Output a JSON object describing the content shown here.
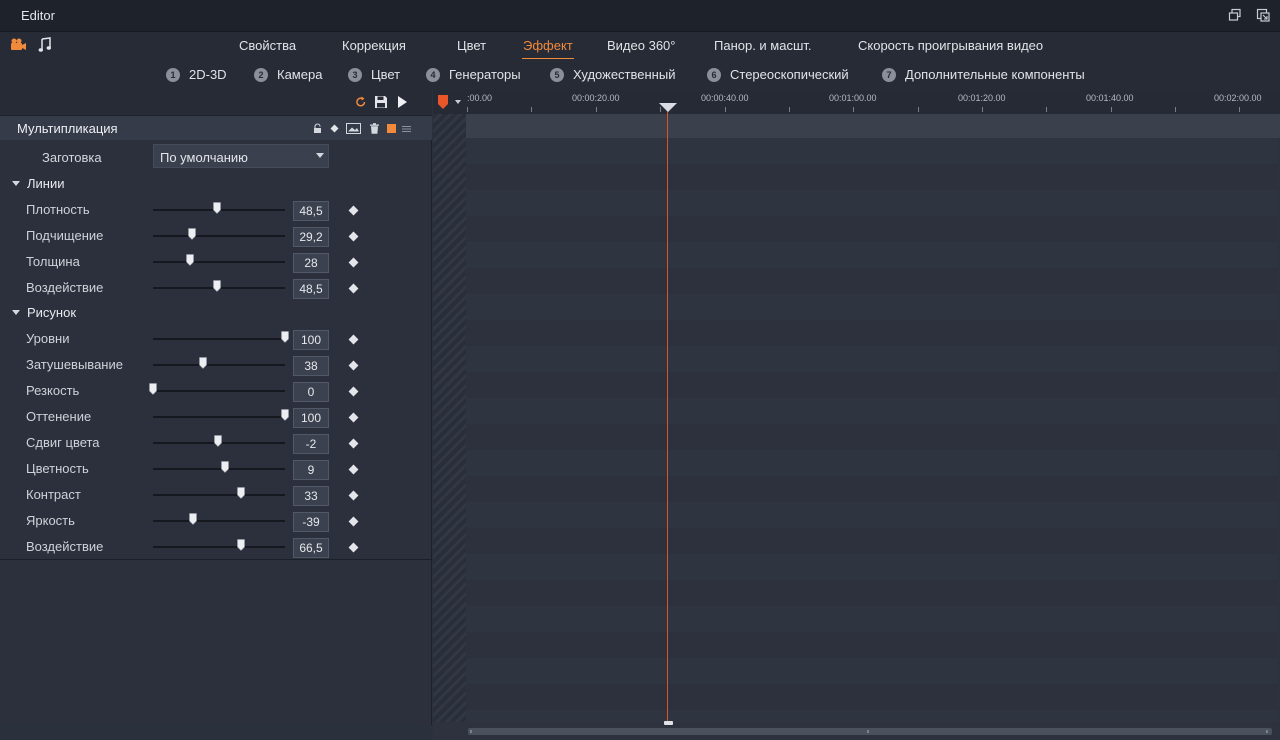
{
  "window": {
    "title": "Editor"
  },
  "media_icons": [
    "camera-icon",
    "music-note-icon"
  ],
  "tabs": [
    {
      "label": "Свойства",
      "active": false
    },
    {
      "label": "Коррекция",
      "active": false
    },
    {
      "label": "Цвет",
      "active": false
    },
    {
      "label": "Эффект",
      "active": true
    },
    {
      "label": "Видео 360°",
      "active": false
    },
    {
      "label": "Панор. и масшт.",
      "active": false
    },
    {
      "label": "Скорость проигрывания видео",
      "active": false
    }
  ],
  "subtabs": [
    {
      "num": "1",
      "label": "2D-3D"
    },
    {
      "num": "2",
      "label": "Камера"
    },
    {
      "num": "3",
      "label": "Цвет"
    },
    {
      "num": "4",
      "label": "Генераторы"
    },
    {
      "num": "5",
      "label": "Художественный"
    },
    {
      "num": "6",
      "label": "Стереоскопический"
    },
    {
      "num": "7",
      "label": "Дополнительные компоненты"
    }
  ],
  "effect": {
    "name": "Мультипликация",
    "preset_label": "Заготовка",
    "preset_value": "По умолчанию",
    "sections": [
      {
        "title": "Линии",
        "params": [
          {
            "label": "Плотность",
            "value": "48,5",
            "fraction": 0.485
          },
          {
            "label": "Подчищение",
            "value": "29,2",
            "fraction": 0.292
          },
          {
            "label": "Толщина",
            "value": "28",
            "fraction": 0.28
          },
          {
            "label": "Воздействие",
            "value": "48,5",
            "fraction": 0.485
          }
        ]
      },
      {
        "title": "Рисунок",
        "params": [
          {
            "label": "Уровни",
            "value": "100",
            "fraction": 1.0
          },
          {
            "label": "Затушевывание",
            "value": "38",
            "fraction": 0.38
          },
          {
            "label": "Резкость",
            "value": "0",
            "fraction": 0.0
          },
          {
            "label": "Оттенение",
            "value": "100",
            "fraction": 1.0
          },
          {
            "label": "Сдвиг цвета",
            "value": "-2",
            "fraction": 0.49
          },
          {
            "label": "Цветность",
            "value": "9",
            "fraction": 0.545
          },
          {
            "label": "Контраст",
            "value": "33",
            "fraction": 0.665
          },
          {
            "label": "Яркость",
            "value": "-39",
            "fraction": 0.305
          },
          {
            "label": "Воздействие",
            "value": "66,5",
            "fraction": 0.665
          }
        ]
      }
    ]
  },
  "timeline": {
    "ticks": [
      ":00.00",
      "00:00:20.00",
      "00:00:40.00",
      "00:01:00.00",
      "00:01:20.00",
      "00:01:40.00",
      "00:02:00.00"
    ],
    "playhead_time_fraction": 0.27
  },
  "colors": {
    "accent": "#f28a3c",
    "playhead": "#d5562b"
  }
}
